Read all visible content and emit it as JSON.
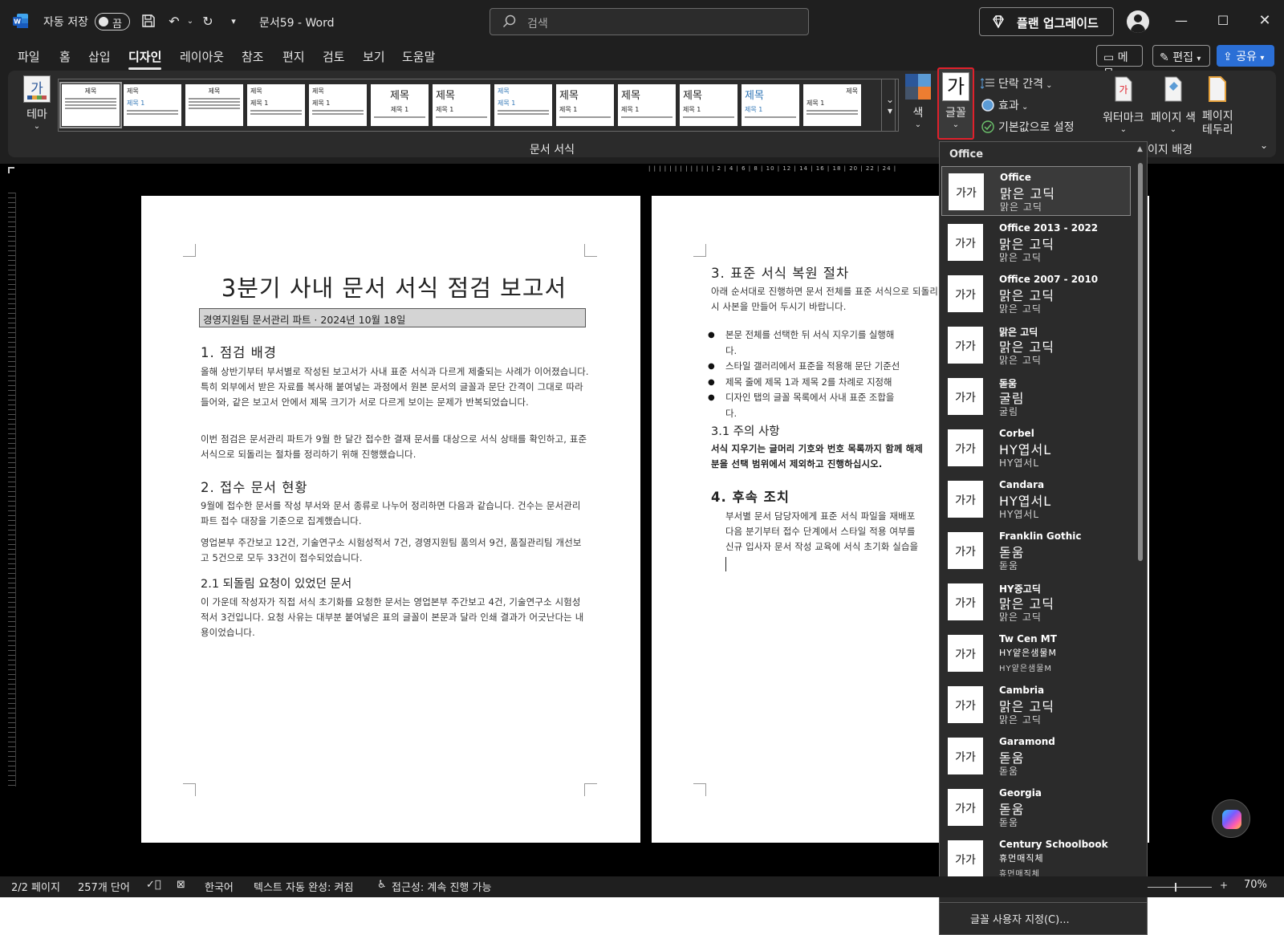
{
  "titlebar": {
    "autosave_label": "자동 저장",
    "autosave_state": "끔",
    "doc_title": "문서59  -  Word",
    "search_placeholder": "검색",
    "upgrade_label": "플랜 업그레이드"
  },
  "tabs": [
    "파일",
    "홈",
    "삽입",
    "디자인",
    "레이아웃",
    "참조",
    "편지",
    "검토",
    "보기",
    "도움말"
  ],
  "active_tab": "디자인",
  "header_buttons": {
    "memo": "메모",
    "edit": "편집",
    "share": "공유"
  },
  "ribbon": {
    "theme_label": "테마",
    "theme_icon_glyph": "가",
    "style_thumb_heading": "제목",
    "style_thumb_sub": "제목 1",
    "colors_label": "색",
    "font_label": "글꼴",
    "font_glyph": "가",
    "paragraph_spacing": "단락 간격",
    "effects": "효과",
    "set_default": "기본값으로 설정",
    "watermark": "워터마크",
    "page_color": "페이지 색",
    "page_borders": "페이지\n테두리",
    "group_document_format": "문서 서식",
    "group_page_background": "이지 배경",
    "accent_color": "#e0202b"
  },
  "ruler_text": "| | | | | | | | | | | | |  2 |  4 |  6 |  8 | 10 | 12 | 14 | 16 | 18 | 20 | 22 | 24 |",
  "page1": {
    "title": "3분기 사내 문서 서식 점검 보고서",
    "subtitle": "경영지원팀 문서관리 파트 · 2024년 10월 18일",
    "s1_heading": "1. 점검 배경",
    "s1_p1": "올해 상반기부터 부서별로 작성된 보고서가 사내 표준 서식과 다르게 제출되는 사례가 이어졌습니다. 특히 외부에서 받은 자료를 복사해 붙여넣는 과정에서 원본 문서의 글꼴과 문단 간격이 그대로 따라 들어와, 같은 보고서 안에서 제목 크기가 서로 다르게 보이는 문제가 반복되었습니다.",
    "s1_p2": "이번 점검은 문서관리 파트가 9월 한 달간 접수한 결재 문서를 대상으로 서식 상태를 확인하고, 표준 서식으로 되돌리는 절차를 정리하기 위해 진행했습니다.",
    "s2_heading": "2. 접수 문서 현황",
    "s2_p1": "9월에 접수한 문서를 작성 부서와 문서 종류로 나누어 정리하면 다음과 같습니다. 건수는 문서관리 파트 접수 대장을 기준으로 집계했습니다.",
    "s2_p2": "영업본부 주간보고 12건, 기술연구소 시험성적서 7건, 경영지원팀 품의서 9건, 품질관리팀 개선보고 5건으로 모두 33건이 접수되었습니다.",
    "s21_heading": "2.1 되돌림 요청이 있었던 문서",
    "s21_p1": "이 가운데 작성자가 직접 서식 초기화를 요청한 문서는 영업본부 주간보고 4건, 기술연구소 시험성적서 3건입니다. 요청 사유는 대부분 붙여넣은 표의 글꼴이 본문과 달라 인쇄 결과가 어긋난다는 내용이었습니다."
  },
  "page2": {
    "s3_heading": "3. 표준 서식 복원 절차",
    "s3_p1": "아래 순서대로 진행하면 문서 전체를 표준 서식으로 되돌리\n시 사본을 만들어 두시기 바랍니다.",
    "bullets": [
      "본문 전체를 선택한 뒤 서식 지우기를 실행해\n다.",
      "스타일 갤러리에서 표준을 적용해 문단 기준선",
      "제목 줄에 제목 1과 제목 2를 차례로 지정해",
      "디자인 탭의 글꼴 목록에서 사내 표준 조합을\n다."
    ],
    "s31_heading": "3.1 주의 사항",
    "s31_p1": "서식 지우기는 글머리 기호와 번호 목록까지 함께 해제\n분을 선택 범위에서 제외하고 진행하십시오.",
    "s4_heading": "4. 후속 조치",
    "s4_p1": "부서별 문서 담당자에게 표준 서식 파일을 재배포\n다음 분기부터 접수 단계에서 스타일 적용 여부를\n신규 입사자 문서 작성 교육에 서식 초기화 실습을"
  },
  "font_panel": {
    "header": "Office",
    "preview_glyph": "가가",
    "items": [
      {
        "name": "Office",
        "heading": "맑은 고딕",
        "body": "맑은 고딕"
      },
      {
        "name": "Office 2013 - 2022",
        "heading": "맑은 고딕",
        "body": "맑은 고딕"
      },
      {
        "name": "Office 2007 - 2010",
        "heading": "맑은 고딕",
        "body": "맑은 고딕"
      },
      {
        "name": "맑은 고딕",
        "heading": "맑은 고딕",
        "body": "맑은 고딕"
      },
      {
        "name": "돋움",
        "heading": "굴림",
        "body": "굴림"
      },
      {
        "name": "Corbel",
        "heading": "HY엽서L",
        "body": "HY엽서L"
      },
      {
        "name": "Candara",
        "heading": "HY엽서L",
        "body": "HY엽서L"
      },
      {
        "name": "Franklin Gothic",
        "heading": "돋움",
        "body": "돋움"
      },
      {
        "name": "HY중고딕",
        "heading": "맑은 고딕",
        "body": "맑은 고딕"
      },
      {
        "name": "Tw Cen MT",
        "heading": "HY얕은샘물M",
        "body": "HY얕은샘물M"
      },
      {
        "name": "Cambria",
        "heading": "맑은 고딕",
        "body": "맑은 고딕"
      },
      {
        "name": "Garamond",
        "heading": "돋움",
        "body": "돋움"
      },
      {
        "name": "Georgia",
        "heading": "돋움",
        "body": "돋움"
      },
      {
        "name": "Century Schoolbook",
        "heading": "휴먼매직체",
        "body": "휴먼매직체"
      }
    ],
    "customize": "글꼴 사용자 지정(C)..."
  },
  "statusbar": {
    "page": "2/2 페이지",
    "words": "257개 단어",
    "language": "한국어",
    "autocomplete": "텍스트 자동 완성: 켜짐",
    "accessibility": "접근성: 계속 진행 가능",
    "zoom": "70%"
  }
}
